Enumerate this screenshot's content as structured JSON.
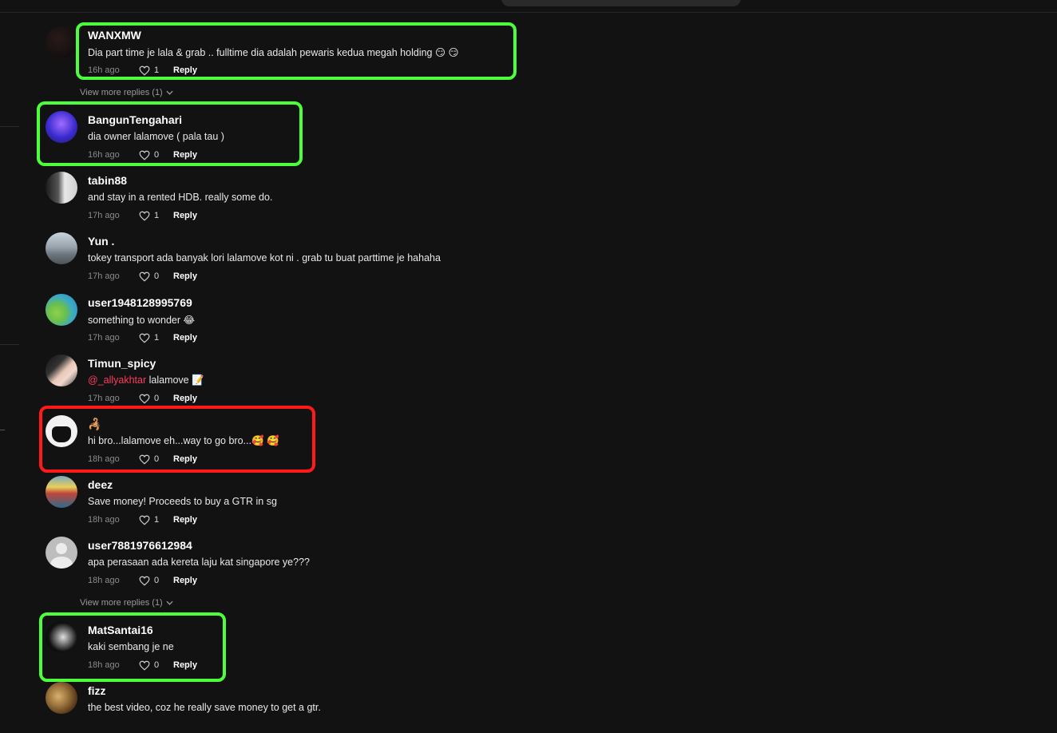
{
  "comments": [
    {
      "username": "WANXMW",
      "text": "Dia part time je lala & grab .. fulltime dia adalah pewaris kedua megah holding 😏 😏",
      "time": "16h ago",
      "likes": "1",
      "reply": "Reply",
      "avatar_color": "#1a1010"
    },
    {
      "username": "BangunTengahari",
      "text": "dia owner lalamove ( pala tau )",
      "time": "16h ago",
      "likes": "0",
      "reply": "Reply",
      "avatar_color": "#5b3bd6"
    },
    {
      "username": "tabin88",
      "text": "and stay in a rented HDB. really some do.",
      "time": "17h ago",
      "likes": "1",
      "reply": "Reply",
      "avatar_color": "#8c8c8c"
    },
    {
      "username": "Yun .",
      "text": "tokey transport ada banyak lori lalamove kot ni . grab tu buat parttime je hahaha",
      "time": "17h ago",
      "likes": "0",
      "reply": "Reply",
      "avatar_color": "#8f99a3"
    },
    {
      "username": "user1948128995769",
      "text": "something to wonder 😂",
      "time": "17h ago",
      "likes": "1",
      "reply": "Reply",
      "avatar_color": "#3aa9c9"
    },
    {
      "username": "Timun_spicy",
      "mention": "@_allyakhtar",
      "text": " lalamove 📝",
      "time": "17h ago",
      "likes": "0",
      "reply": "Reply",
      "avatar_color": "#6a6a6a"
    },
    {
      "username": "🦂",
      "text": "hi bro...lalamove eh...way to go bro...🥰 🥰",
      "time": "18h ago",
      "likes": "0",
      "reply": "Reply",
      "avatar_color": "#f2f2f2"
    },
    {
      "username": "deez",
      "text": "Save money! Proceeds to buy a GTR in sg",
      "time": "18h ago",
      "likes": "1",
      "reply": "Reply",
      "avatar_color": "#2d6b8c"
    },
    {
      "username": "user7881976612984",
      "text": "apa perasaan ada kereta laju kat singapore ye???",
      "time": "18h ago",
      "likes": "0",
      "reply": "Reply",
      "avatar_color": "#bdbdbd"
    },
    {
      "username": "MatSantai16",
      "text": "kaki sembang je ne",
      "time": "18h ago",
      "likes": "0",
      "reply": "Reply",
      "avatar_color": "#222222"
    },
    {
      "username": "fizz",
      "text": "the best video, coz he really save money to get a gtr.",
      "time": "",
      "likes": "",
      "reply": "",
      "avatar_color": "#7a5a3a"
    }
  ],
  "view_more": [
    {
      "label": "View more replies (1)"
    },
    {
      "label": "View more replies (1)"
    }
  ],
  "colors": {
    "highlight_green": "#4cff3a",
    "highlight_red": "#ff1a1a",
    "mention": "#ff3b5c",
    "background": "#121212"
  },
  "icons": {
    "like": "heart-outline-icon",
    "expand": "chevron-down-icon"
  }
}
